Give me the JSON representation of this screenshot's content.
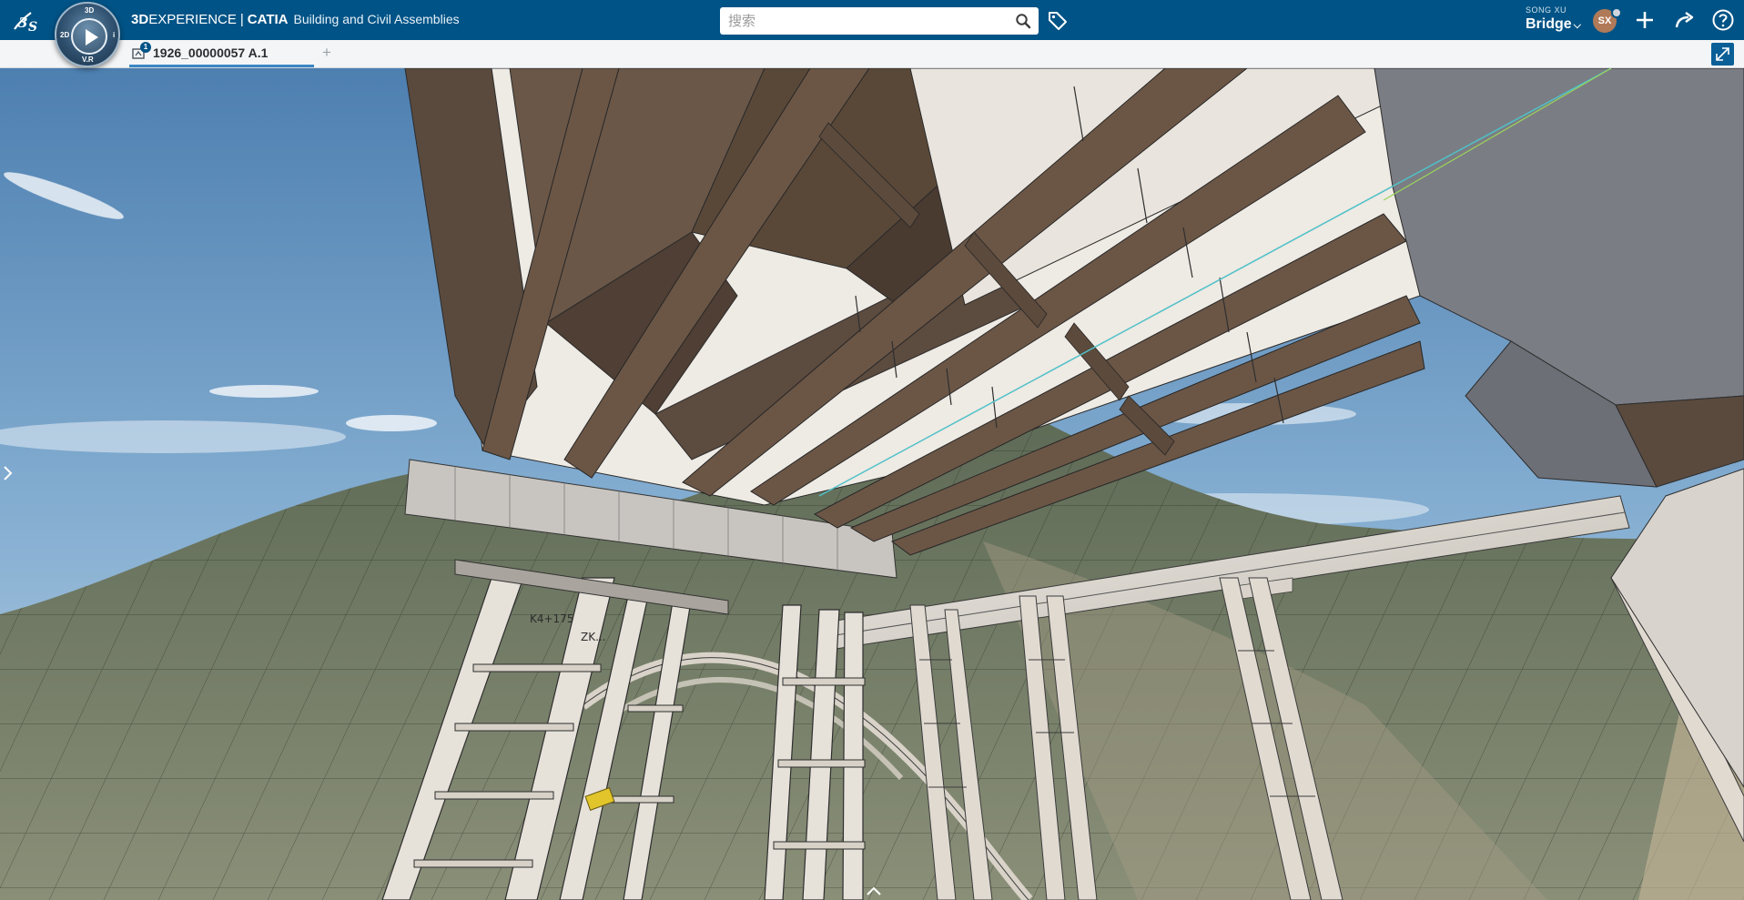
{
  "header": {
    "brand_3d": "3D",
    "brand_experience": "EXPERIENCE",
    "brand_sep": "|",
    "brand_catia": "CATIA",
    "app_name": "Building and Civil Assemblies",
    "compass_labels": {
      "top": "3D",
      "left": "2D",
      "right": "i",
      "bottom": "V.R"
    }
  },
  "search": {
    "placeholder": "搜索"
  },
  "user": {
    "name": "SONG XU",
    "initials": "SX",
    "collaborative_space": "Bridge"
  },
  "tabs": [
    {
      "title": "1926_00000057 A.1",
      "badge": "1",
      "active": true
    }
  ],
  "viewport": {
    "labels": [
      "K4+175",
      "ZK..."
    ]
  },
  "colors": {
    "topbar": "#005386",
    "tab_underline": "#3b86c6",
    "girder": "#5b4a3f",
    "steel": "#e2ddd6",
    "sky": "#7aa3c8"
  },
  "icons": {
    "logo": "3ds-logo-icon",
    "compass": "compass-icon",
    "search": "search-icon",
    "tag": "tag-icon",
    "add": "plus-icon",
    "share": "share-icon",
    "help": "help-icon",
    "maximize": "maximize-icon",
    "side": "chevron-right-icon",
    "bottom": "chevron-up-icon"
  }
}
